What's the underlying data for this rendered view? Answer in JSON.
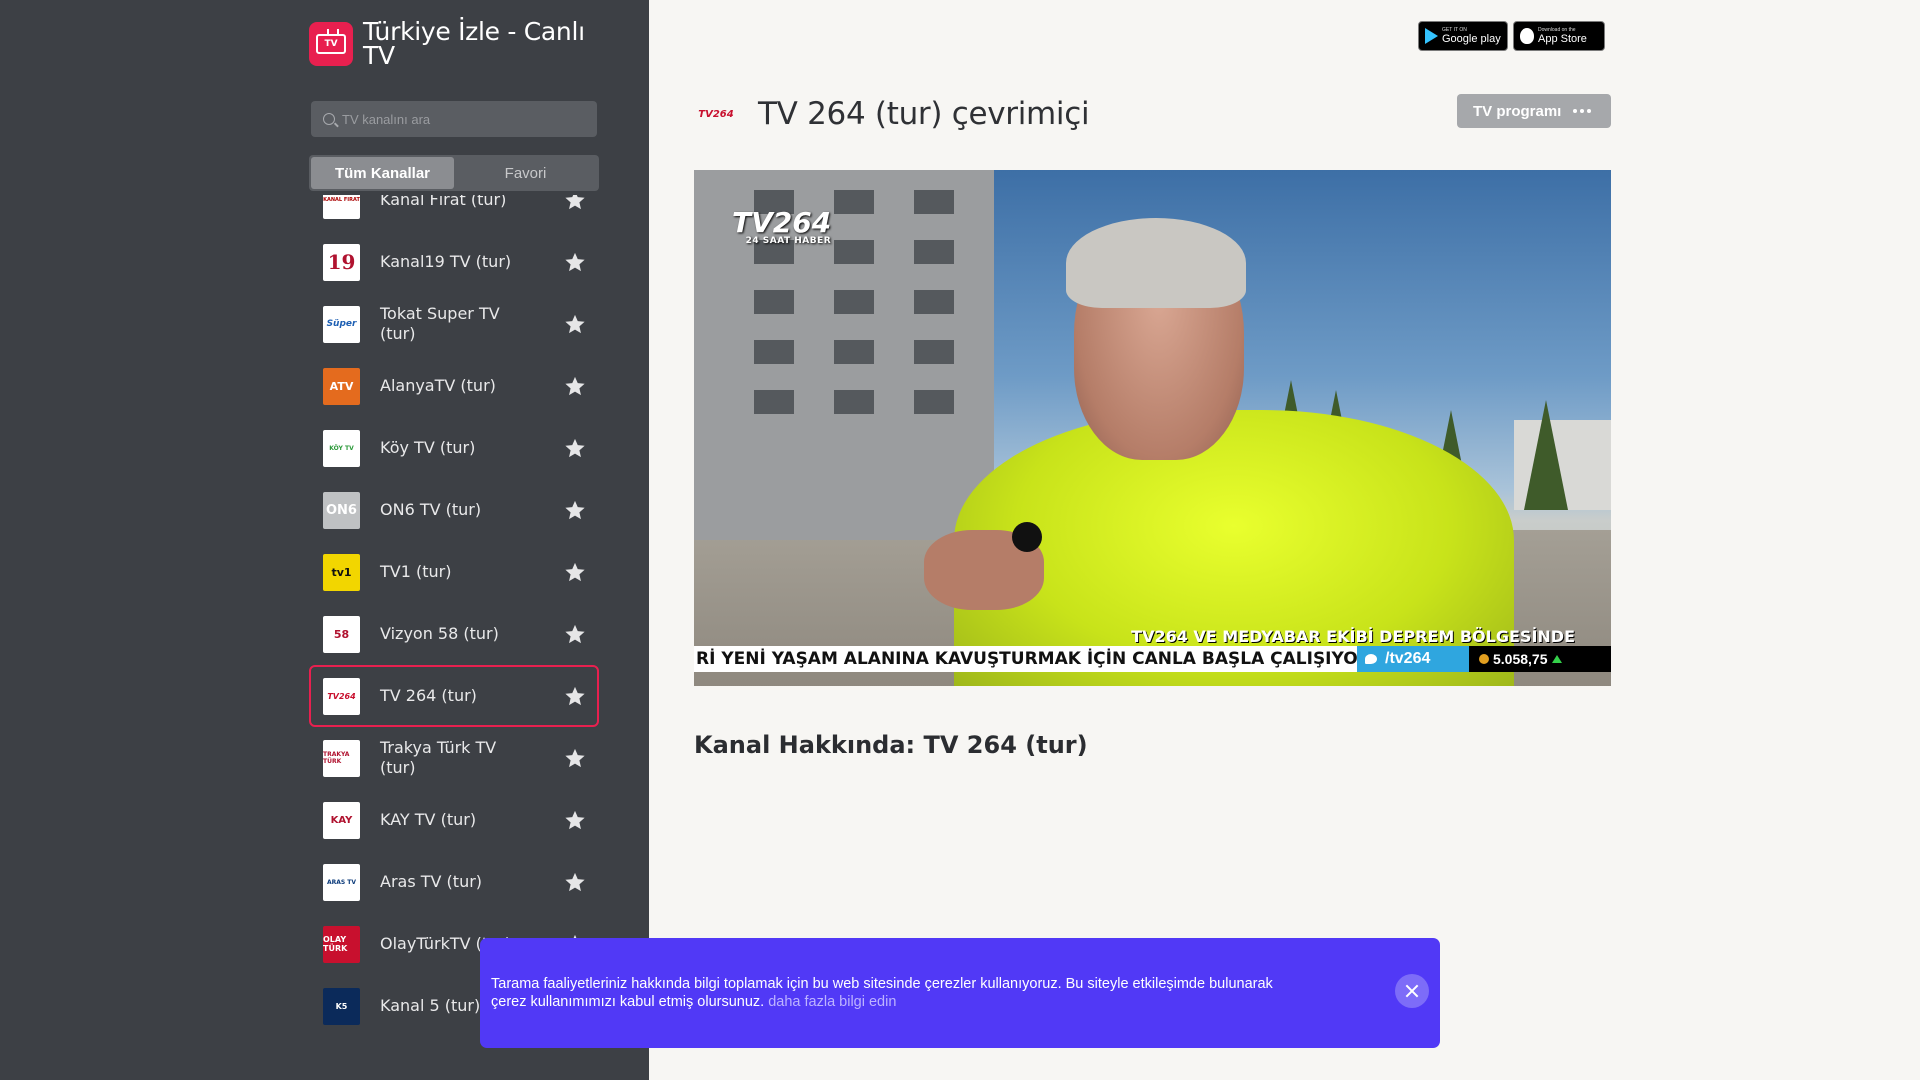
{
  "brand": {
    "title": "Türkiye İzle - Canlı TV",
    "logo_text": "TV"
  },
  "search": {
    "placeholder": "TV kanalını ara"
  },
  "tabs": {
    "all": "Tüm Kanallar",
    "favorites": "Favori"
  },
  "channels": [
    {
      "name": "Kanal Fırat (tur)",
      "logo": "KANAL FIRAT"
    },
    {
      "name": "Kanal19 TV (tur)",
      "logo": "19"
    },
    {
      "name": "Tokat Super TV (tur)",
      "logo": "Süper"
    },
    {
      "name": "AlanyaTV (tur)",
      "logo": "ATV"
    },
    {
      "name": "Köy TV (tur)",
      "logo": "KÖY TV"
    },
    {
      "name": "ON6 TV (tur)",
      "logo": "ON6"
    },
    {
      "name": "TV1 (tur)",
      "logo": "tv1"
    },
    {
      "name": "Vizyon 58 (tur)",
      "logo": "58"
    },
    {
      "name": "TV 264 (tur)",
      "logo": "TV264"
    },
    {
      "name": "Trakya Türk TV (tur)",
      "logo": "TRAKYA TÜRK"
    },
    {
      "name": "KAY TV (tur)",
      "logo": "KAY"
    },
    {
      "name": "Aras TV (tur)",
      "logo": "ARAS TV"
    },
    {
      "name": "OlayTürkTV (tur)",
      "logo": "OLAY TÜRK"
    },
    {
      "name": "Kanal 5 (tur)",
      "logo": "K5"
    }
  ],
  "active_channel_index": 8,
  "store": {
    "google_small": "GET IT ON",
    "google_big": "Google play",
    "apple_small": "Download on the",
    "apple_big": "App Store"
  },
  "page": {
    "title": "TV 264 (tur) çevrimiçi",
    "title_logo": "TV264",
    "program_button": "TV programı",
    "about": "Kanal Hakkında: TV 264 (tur)"
  },
  "video": {
    "watermark": "TV264",
    "watermark_sub": "24 SAAT HABER",
    "headline": "TV264 VE MEDYABAR EKİBİ DEPREM BÖLGESİNDE",
    "ticker": "Rİ YENİ YAŞAM ALANINA KAVUŞTURMAK İÇİN CANLA BAŞLA ÇALIŞIYOR",
    "handle": "/tv264",
    "score": "5.058,75"
  },
  "cookie": {
    "text": "Tarama faaliyetleriniz hakkında bilgi toplamak için bu web sitesinde çerezler kullanıyoruz. Bu siteyle etkileşimde bulunarak çerez kullanımımızı kabul etmiş olursunuz.",
    "link": "daha fazla bilgi edin"
  },
  "colors": {
    "accent": "#e8204f",
    "sidebar": "#3d4045",
    "cookie": "#5139f6"
  }
}
